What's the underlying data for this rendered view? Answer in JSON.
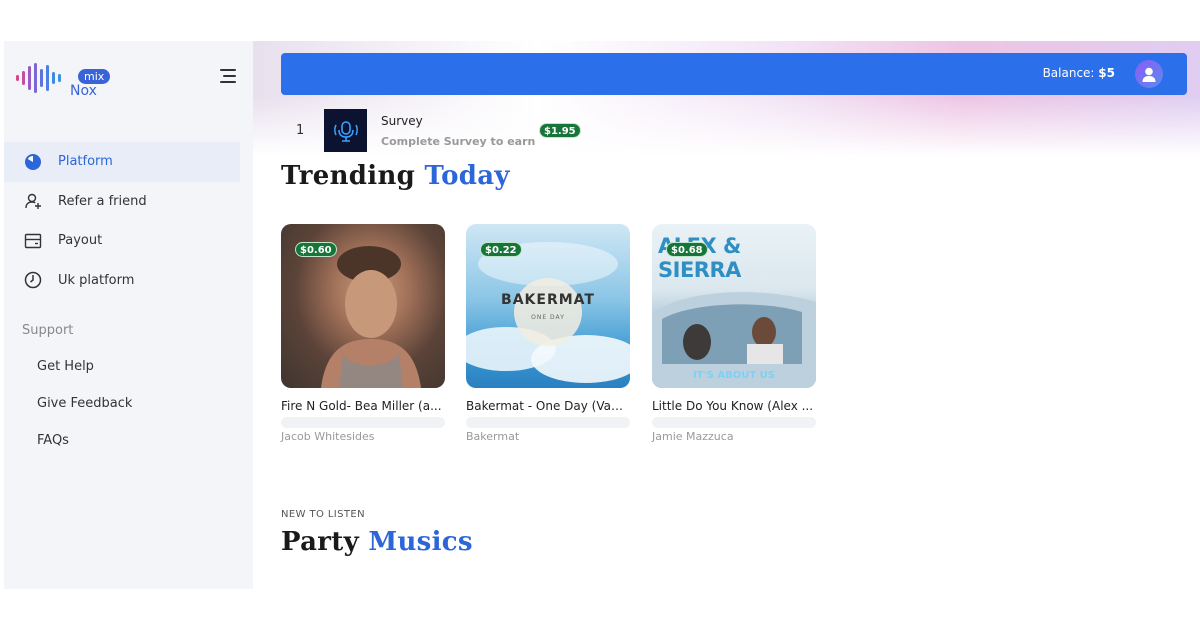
{
  "logo": {
    "pill": "mix",
    "name": "Nox"
  },
  "nav": {
    "items": [
      {
        "label": "Platform",
        "icon": "pie-chart-icon",
        "active": true
      },
      {
        "label": "Refer a friend",
        "icon": "add-user-icon",
        "active": false
      },
      {
        "label": "Payout",
        "icon": "wallet-icon",
        "active": false
      },
      {
        "label": "Uk platform",
        "icon": "clock-icon",
        "active": false
      }
    ]
  },
  "support": {
    "heading": "Support",
    "items": [
      "Get Help",
      "Give Feedback",
      "FAQs"
    ]
  },
  "topbar": {
    "balance_label": "Balance:",
    "balance_value": "$5"
  },
  "survey": {
    "rank": "1",
    "title": "Survey",
    "subtitle": "Complete Survey to earn",
    "reward": "$1.95"
  },
  "trending": {
    "title_a": "Trending",
    "title_b": "Today"
  },
  "cards": [
    {
      "price": "$0.60",
      "title": "Fire N Gold- Bea Miller (a...",
      "artist": "Jacob Whitesides"
    },
    {
      "price": "$0.22",
      "title": "Bakermat - One Day (Van...",
      "artist": "Bakermat",
      "art_text": "BAKERMAT",
      "art_sub": "ONE DAY"
    },
    {
      "price": "$0.68",
      "title": "Little Do You Know (Alex ...",
      "artist": "Jamie Mazzuca",
      "art_text": "ALEX & SIERRA",
      "art_sub": "IT'S ABOUT US"
    }
  ],
  "new_section": {
    "kicker": "NEW TO LISTEN",
    "title_a": "Party",
    "title_b": "Musics"
  },
  "colors": {
    "accent": "#2c66d8",
    "topbar": "#2b70ea",
    "badge": "#17753a"
  }
}
